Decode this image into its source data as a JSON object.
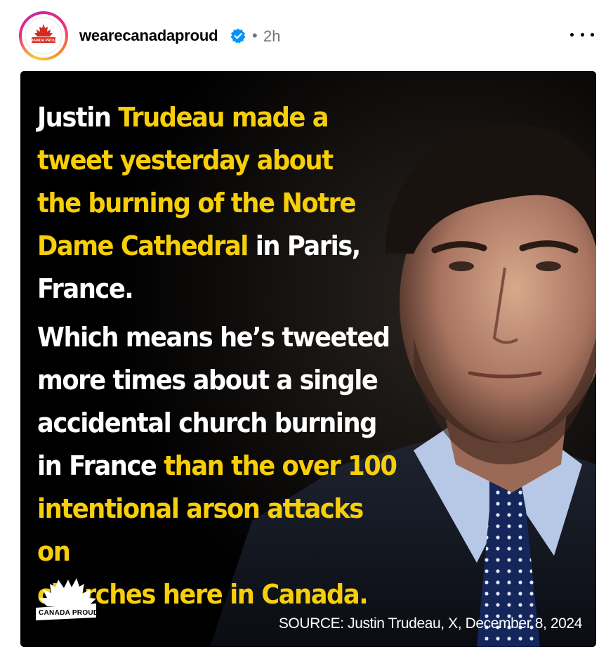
{
  "header": {
    "username": "wearecanadaproud",
    "separator": "•",
    "time": "2h",
    "avatar_text": "CANADA PROUD"
  },
  "post": {
    "paragraph1": [
      {
        "text": "Justin ",
        "highlight": false
      },
      {
        "text": "Trudeau made a",
        "highlight": true
      },
      {
        "text": "tweet yesterday about",
        "highlight": true
      },
      {
        "text": "the burning of the Notre",
        "highlight": true
      },
      {
        "text": "Dame Cathedral",
        "highlight": true
      },
      {
        "text": " in Paris,",
        "highlight": false
      },
      {
        "text": "France.",
        "highlight": false
      }
    ],
    "paragraph2": [
      {
        "text": "Which means he’s tweeted",
        "highlight": false
      },
      {
        "text": "more times about a single",
        "highlight": false
      },
      {
        "text": "accidental church burning",
        "highlight": false
      },
      {
        "text": "in France ",
        "highlight": false
      },
      {
        "text": "than the over 100",
        "highlight": true
      },
      {
        "text": "intentional arson attacks on",
        "highlight": true
      },
      {
        "text": "churches here in Canada.",
        "highlight": true
      }
    ],
    "brand": "CANADA PROUD",
    "source": "SOURCE: Justin Trudeau, X, December 8, 2024"
  },
  "colors": {
    "highlight": "#f7ce0a",
    "verified": "#0095f6",
    "brand_red": "#d52b1e"
  }
}
